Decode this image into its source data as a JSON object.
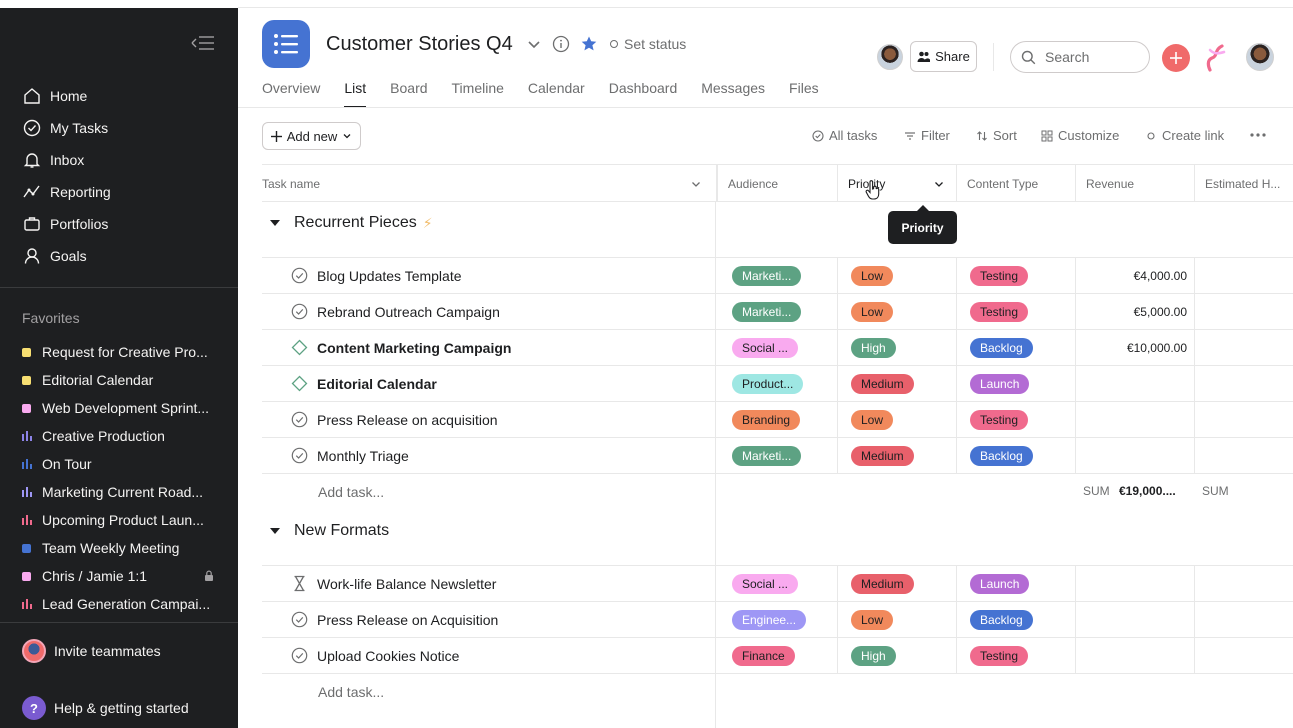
{
  "sidebar": {
    "nav": [
      {
        "label": "Home",
        "icon": "home-icon"
      },
      {
        "label": "My Tasks",
        "icon": "check-circle-icon"
      },
      {
        "label": "Inbox",
        "icon": "bell-icon"
      },
      {
        "label": "Reporting",
        "icon": "reporting-icon"
      },
      {
        "label": "Portfolios",
        "icon": "portfolio-icon"
      },
      {
        "label": "Goals",
        "icon": "goals-icon"
      }
    ],
    "favorites_header": "Favorites",
    "favorites": [
      {
        "label": "Request for Creative Pro...",
        "color": "#f8df72",
        "kind": "square"
      },
      {
        "label": "Editorial Calendar",
        "color": "#f8df72",
        "kind": "square"
      },
      {
        "label": "Web Development Sprint...",
        "color": "#f9aaef",
        "kind": "square"
      },
      {
        "label": "Creative Production",
        "color": "#8d84e8",
        "kind": "bars"
      },
      {
        "label": "On Tour",
        "color": "#4573d2",
        "kind": "bars"
      },
      {
        "label": "Marketing Current Road...",
        "color": "#9e97f5",
        "kind": "bars"
      },
      {
        "label": "Upcoming Product Laun...",
        "color": "#f06a8d",
        "kind": "bars"
      },
      {
        "label": "Team Weekly Meeting",
        "color": "#4573d2",
        "kind": "square"
      },
      {
        "label": "Chris / Jamie 1:1",
        "color": "#f9aaef",
        "kind": "square"
      },
      {
        "label": "Lead Generation Campai...",
        "color": "#f06a8d",
        "kind": "bars"
      }
    ],
    "invite_label": "Invite teammates",
    "help_label": "Help & getting started"
  },
  "header": {
    "title": "Customer Stories Q4",
    "set_status": "Set status",
    "share_label": "Share",
    "search_placeholder": "Search",
    "accent": "#4573d2"
  },
  "tabs": [
    "Overview",
    "List",
    "Board",
    "Timeline",
    "Calendar",
    "Dashboard",
    "Messages",
    "Files"
  ],
  "active_tab": "List",
  "toolbar": {
    "add_new": "Add new",
    "all_tasks": "All tasks",
    "filter": "Filter",
    "sort": "Sort",
    "customize": "Customize",
    "create_link": "Create link"
  },
  "columns": [
    "Task name",
    "Audience",
    "Priority",
    "Content Type",
    "Revenue",
    "Estimated H..."
  ],
  "tooltip": "Priority",
  "sections": [
    {
      "title": "Recurrent Pieces",
      "tasks": [
        {
          "name": "Blog Updates Template",
          "audience": "Marketi...",
          "priority": "Low",
          "type": "Testing",
          "revenue": "€4,000.00"
        },
        {
          "name": "Rebrand Outreach Campaign",
          "audience": "Marketi...",
          "priority": "Low",
          "type": "Testing",
          "revenue": "€5,000.00"
        },
        {
          "name": "Content Marketing Campaign",
          "audience": "Social ...",
          "priority": "High",
          "type": "Backlog",
          "revenue": "€10,000.00"
        },
        {
          "name": "Editorial Calendar",
          "audience": "Product...",
          "priority": "Medium",
          "type": "Launch",
          "revenue": ""
        },
        {
          "name": "Press Release on acquisition",
          "audience": "Branding",
          "priority": "Low",
          "type": "Testing",
          "revenue": ""
        },
        {
          "name": "Monthly Triage",
          "audience": "Marketi...",
          "priority": "Medium",
          "type": "Backlog",
          "revenue": ""
        }
      ],
      "add_task": "Add task...",
      "sum_label": "SUM",
      "sum_value": "€19,000....",
      "sum_label2": "SUM"
    },
    {
      "title": "New Formats",
      "tasks": [
        {
          "name": "Work-life Balance Newsletter",
          "audience": "Social ...",
          "priority": "Medium",
          "type": "Launch",
          "revenue": ""
        },
        {
          "name": "Press Release on Acquisition",
          "audience": "Enginee...",
          "priority": "Low",
          "type": "Backlog",
          "revenue": ""
        },
        {
          "name": "Upload Cookies Notice",
          "audience": "Finance",
          "priority": "High",
          "type": "Testing",
          "revenue": ""
        }
      ],
      "add_task": "Add task..."
    }
  ]
}
